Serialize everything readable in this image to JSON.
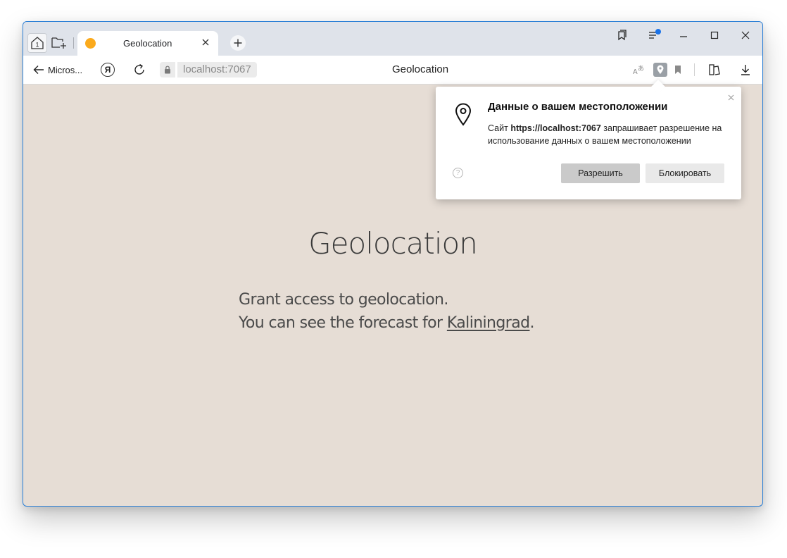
{
  "tabbar": {
    "tab": {
      "title": "Geolocation"
    }
  },
  "addressbar": {
    "back_label": "Micros...",
    "yandex_label": "Я",
    "url": "localhost:7067",
    "page_title": "Geolocation"
  },
  "page": {
    "heading": "Geolocation",
    "line1": "Grant access to geolocation.",
    "line2_prefix": "You can see the forecast for ",
    "city": "Kaliningrad",
    "line2_suffix": "."
  },
  "popup": {
    "title": "Данные о вашем местоположении",
    "msg_prefix": "Сайт ",
    "msg_site": "https://localhost:7067",
    "msg_suffix": " запрашивает разрешение на использование данных о вашем местоположении",
    "help_symbol": "?",
    "allow_label": "Разрешить",
    "block_label": "Блокировать"
  },
  "colors": {
    "page_background": "#e6ddd5",
    "favicon": "#fbaa1c",
    "notification_dot": "#1a73e8",
    "window_border": "#2b7fd6"
  },
  "icons": {
    "home": "home-icon",
    "new_group": "new-folder-icon",
    "tab_close": "close-icon",
    "new_tab": "plus-icon",
    "collections": "collections-icon",
    "menu": "menu-icon",
    "minimize": "minimize-icon",
    "maximize": "maximize-icon",
    "close_window": "close-icon",
    "back": "arrow-left-icon",
    "reload": "reload-icon",
    "lock": "lock-icon",
    "translate": "translate-icon",
    "geolocation": "location-pin-icon",
    "bookmark": "bookmark-icon",
    "reader": "reader-mode-icon",
    "download": "download-icon"
  }
}
